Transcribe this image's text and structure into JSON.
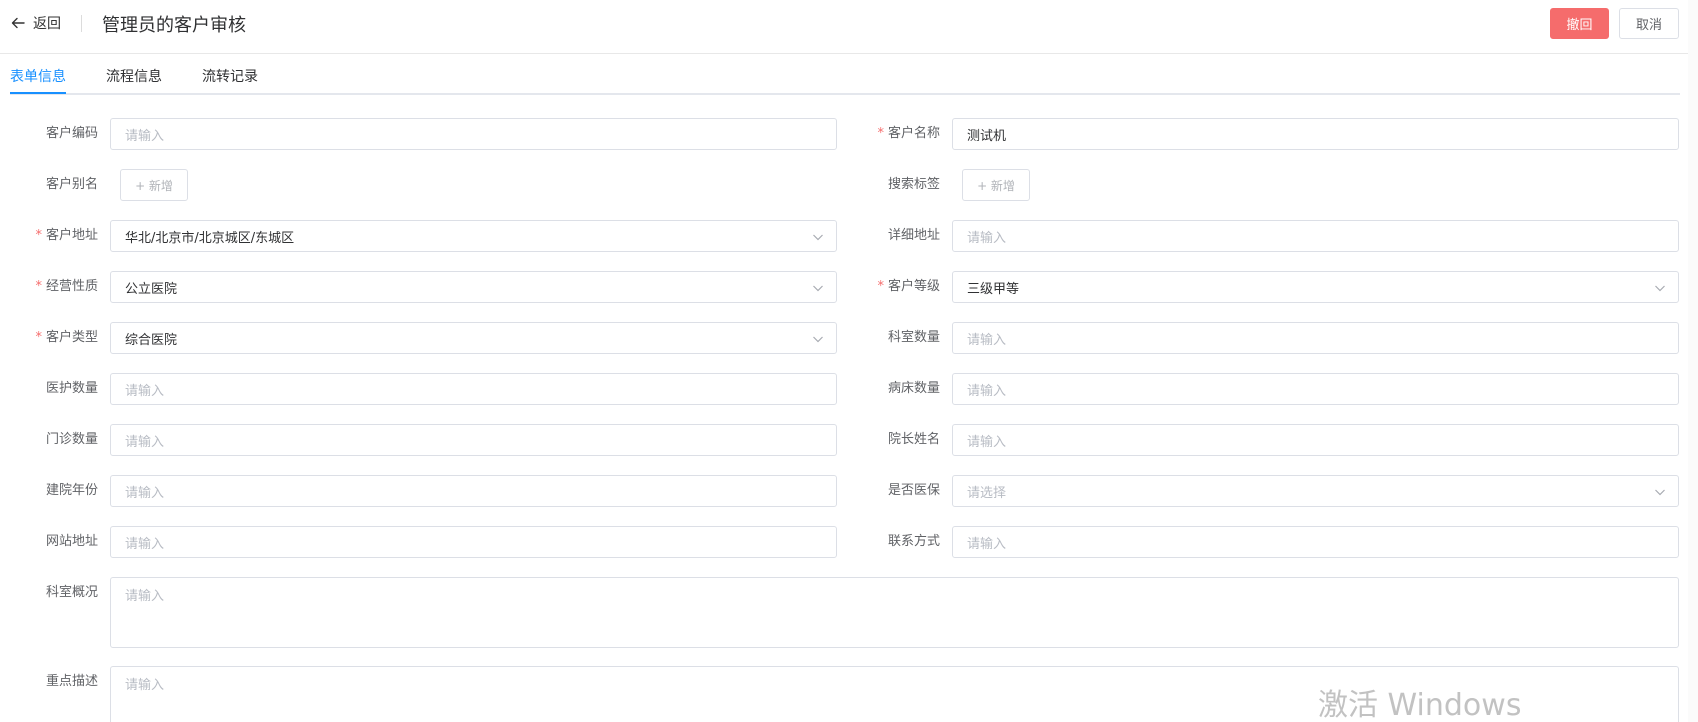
{
  "header": {
    "back_label": "返回",
    "title": "管理员的客户审核",
    "revoke_label": "撤回",
    "cancel_label": "取消"
  },
  "tabs": [
    {
      "label": "表单信息",
      "active": true
    },
    {
      "label": "流程信息",
      "active": false
    },
    {
      "label": "流转记录",
      "active": false
    }
  ],
  "form": {
    "customer_code": {
      "label": "客户编码",
      "placeholder": "请输入"
    },
    "customer_name": {
      "label": "客户名称",
      "value": "测试机"
    },
    "customer_alias": {
      "label": "客户别名",
      "add_label": "+ 新增"
    },
    "search_tags": {
      "label": "搜索标签",
      "add_label": "+ 新增"
    },
    "customer_address": {
      "label": "客户地址",
      "value": "华北/北京市/北京城区/东城区"
    },
    "detail_address": {
      "label": "详细地址",
      "placeholder": "请输入"
    },
    "business_nature": {
      "label": "经营性质",
      "value": "公立医院"
    },
    "customer_level": {
      "label": "客户等级",
      "value": "三级甲等"
    },
    "customer_type": {
      "label": "客户类型",
      "value": "综合医院"
    },
    "department_count": {
      "label": "科室数量",
      "placeholder": "请输入"
    },
    "medical_staff_count": {
      "label": "医护数量",
      "placeholder": "请输入"
    },
    "bed_count": {
      "label": "病床数量",
      "placeholder": "请输入"
    },
    "outpatient_count": {
      "label": "门诊数量",
      "placeholder": "请输入"
    },
    "director_name": {
      "label": "院长姓名",
      "placeholder": "请输入"
    },
    "founded_year": {
      "label": "建院年份",
      "placeholder": "请输入"
    },
    "medical_insurance": {
      "label": "是否医保",
      "placeholder": "请选择"
    },
    "website": {
      "label": "网站地址",
      "placeholder": "请输入"
    },
    "contact": {
      "label": "联系方式",
      "placeholder": "请输入"
    },
    "department_overview": {
      "label": "科室概况",
      "placeholder": "请输入"
    },
    "key_description": {
      "label": "重点描述",
      "placeholder": "请输入"
    }
  },
  "watermark": "激活 Windows",
  "colors": {
    "primary": "#1890ff",
    "danger": "#f56c6c",
    "border": "#dcdfe6",
    "required": "#f56c6c"
  }
}
